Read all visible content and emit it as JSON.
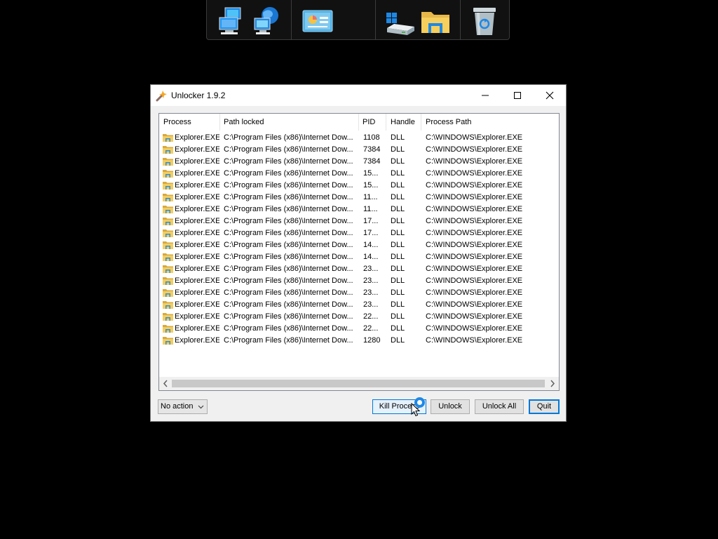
{
  "dock": {
    "icons": [
      "network-computers-icon",
      "globe-network-icon",
      "control-panel-icon",
      "windows-drive-icon",
      "file-explorer-folder-icon",
      "recycle-bin-icon"
    ]
  },
  "window": {
    "title": "Unlocker 1.9.2",
    "columns": [
      "Process",
      "Path locked",
      "PID",
      "Handle",
      "Process Path"
    ],
    "rows": [
      {
        "process": "Explorer.EXE",
        "path": "C:\\Program Files (x86)\\Internet Dow...",
        "pid": "1108",
        "handle": "DLL",
        "process_path": "C:\\WINDOWS\\Explorer.EXE"
      },
      {
        "process": "Explorer.EXE",
        "path": "C:\\Program Files (x86)\\Internet Dow...",
        "pid": "7384",
        "handle": "DLL",
        "process_path": "C:\\WINDOWS\\Explorer.EXE"
      },
      {
        "process": "Explorer.EXE",
        "path": "C:\\Program Files (x86)\\Internet Dow...",
        "pid": "7384",
        "handle": "DLL",
        "process_path": "C:\\WINDOWS\\Explorer.EXE"
      },
      {
        "process": "Explorer.EXE",
        "path": "C:\\Program Files (x86)\\Internet Dow...",
        "pid": "15...",
        "handle": "DLL",
        "process_path": "C:\\WINDOWS\\Explorer.EXE"
      },
      {
        "process": "Explorer.EXE",
        "path": "C:\\Program Files (x86)\\Internet Dow...",
        "pid": "15...",
        "handle": "DLL",
        "process_path": "C:\\WINDOWS\\Explorer.EXE"
      },
      {
        "process": "Explorer.EXE",
        "path": "C:\\Program Files (x86)\\Internet Dow...",
        "pid": "11...",
        "handle": "DLL",
        "process_path": "C:\\WINDOWS\\Explorer.EXE"
      },
      {
        "process": "Explorer.EXE",
        "path": "C:\\Program Files (x86)\\Internet Dow...",
        "pid": "11...",
        "handle": "DLL",
        "process_path": "C:\\WINDOWS\\Explorer.EXE"
      },
      {
        "process": "Explorer.EXE",
        "path": "C:\\Program Files (x86)\\Internet Dow...",
        "pid": "17...",
        "handle": "DLL",
        "process_path": "C:\\WINDOWS\\Explorer.EXE"
      },
      {
        "process": "Explorer.EXE",
        "path": "C:\\Program Files (x86)\\Internet Dow...",
        "pid": "17...",
        "handle": "DLL",
        "process_path": "C:\\WINDOWS\\Explorer.EXE"
      },
      {
        "process": "Explorer.EXE",
        "path": "C:\\Program Files (x86)\\Internet Dow...",
        "pid": "14...",
        "handle": "DLL",
        "process_path": "C:\\WINDOWS\\Explorer.EXE"
      },
      {
        "process": "Explorer.EXE",
        "path": "C:\\Program Files (x86)\\Internet Dow...",
        "pid": "14...",
        "handle": "DLL",
        "process_path": "C:\\WINDOWS\\Explorer.EXE"
      },
      {
        "process": "Explorer.EXE",
        "path": "C:\\Program Files (x86)\\Internet Dow...",
        "pid": "23...",
        "handle": "DLL",
        "process_path": "C:\\WINDOWS\\Explorer.EXE"
      },
      {
        "process": "Explorer.EXE",
        "path": "C:\\Program Files (x86)\\Internet Dow...",
        "pid": "23...",
        "handle": "DLL",
        "process_path": "C:\\WINDOWS\\Explorer.EXE"
      },
      {
        "process": "Explorer.EXE",
        "path": "C:\\Program Files (x86)\\Internet Dow...",
        "pid": "23...",
        "handle": "DLL",
        "process_path": "C:\\WINDOWS\\Explorer.EXE"
      },
      {
        "process": "Explorer.EXE",
        "path": "C:\\Program Files (x86)\\Internet Dow...",
        "pid": "23...",
        "handle": "DLL",
        "process_path": "C:\\WINDOWS\\Explorer.EXE"
      },
      {
        "process": "Explorer.EXE",
        "path": "C:\\Program Files (x86)\\Internet Dow...",
        "pid": "22...",
        "handle": "DLL",
        "process_path": "C:\\WINDOWS\\Explorer.EXE"
      },
      {
        "process": "Explorer.EXE",
        "path": "C:\\Program Files (x86)\\Internet Dow...",
        "pid": "22...",
        "handle": "DLL",
        "process_path": "C:\\WINDOWS\\Explorer.EXE"
      },
      {
        "process": "Explorer.EXE",
        "path": "C:\\Program Files (x86)\\Internet Dow...",
        "pid": "1280",
        "handle": "DLL",
        "process_path": "C:\\WINDOWS\\Explorer.EXE"
      }
    ],
    "action_select": "No action",
    "buttons": {
      "kill": "Kill Process",
      "unlock": "Unlock",
      "unlock_all": "Unlock All",
      "quit": "Quit"
    }
  },
  "colors": {
    "accent": "#0078d7",
    "folder_yellow": "#e8b84a"
  }
}
